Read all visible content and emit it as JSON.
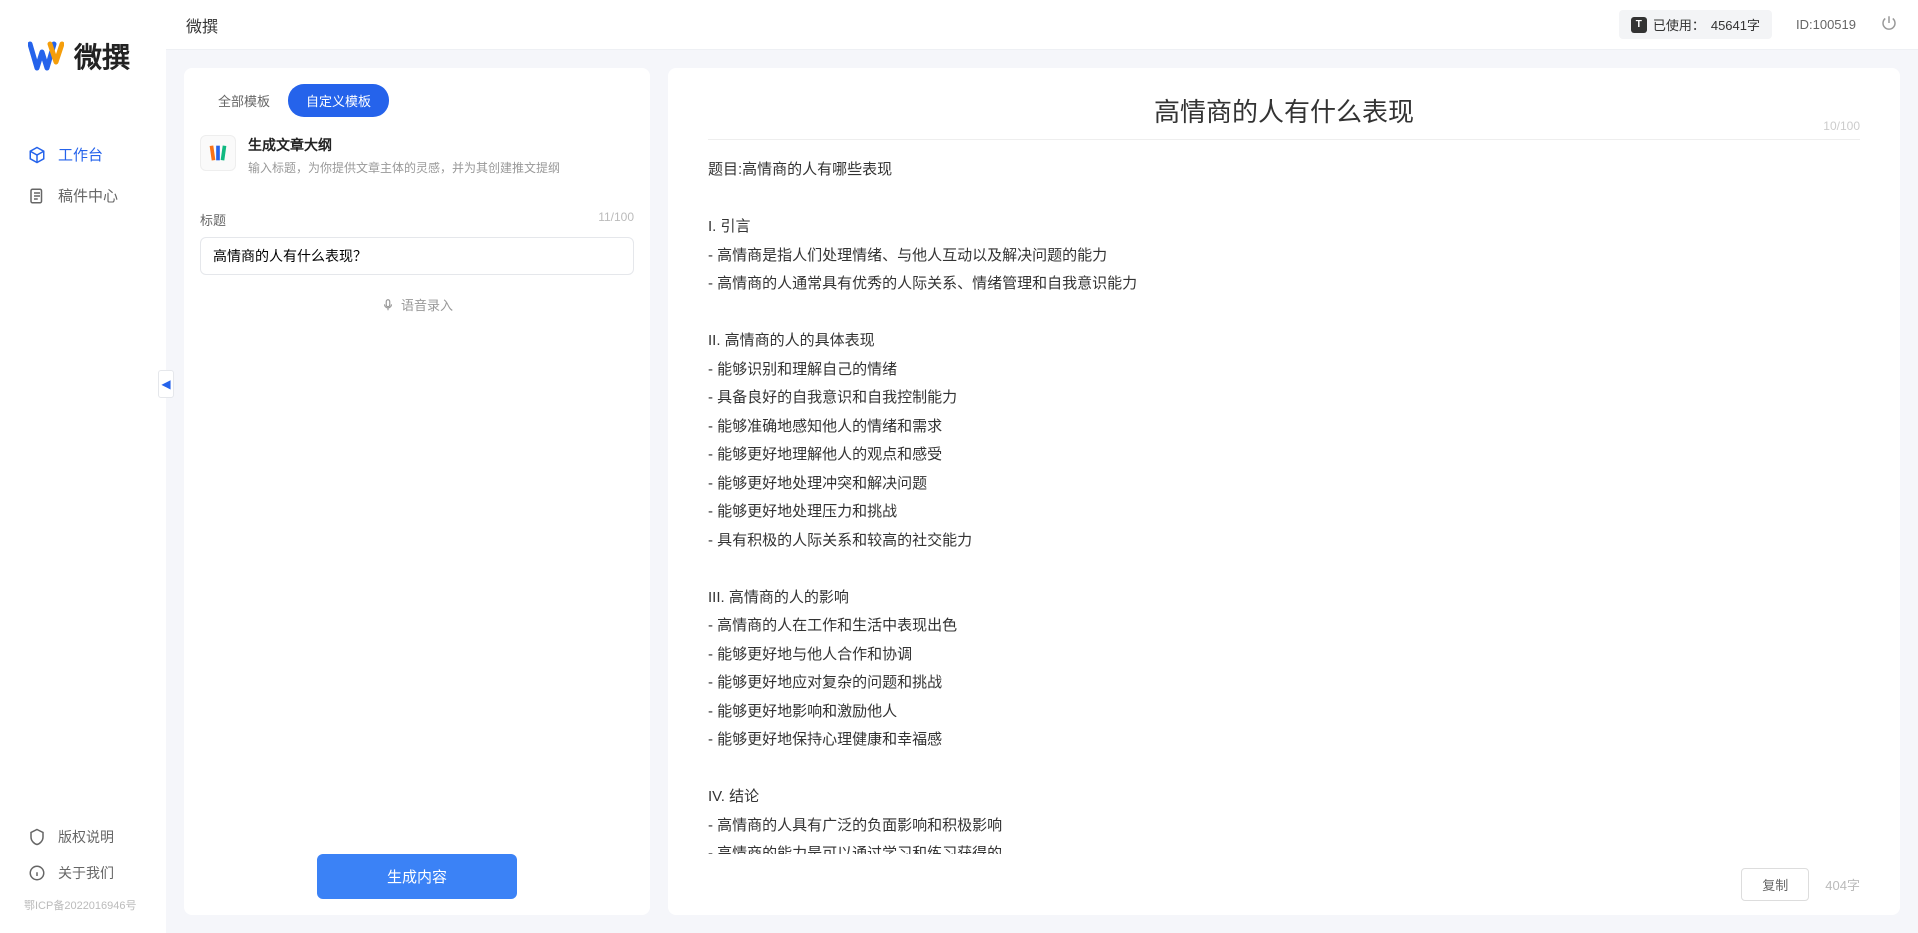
{
  "app": {
    "name": "微撰",
    "breadcrumb": "微撰"
  },
  "sidebar": {
    "nav": [
      {
        "label": "工作台",
        "active": true
      },
      {
        "label": "稿件中心",
        "active": false
      }
    ],
    "footer": [
      {
        "label": "版权说明"
      },
      {
        "label": "关于我们"
      }
    ],
    "icp": "鄂ICP备2022016946号"
  },
  "topbar": {
    "usage_prefix": "已使用：",
    "usage_value": "45641字",
    "user_id": "ID:100519"
  },
  "left": {
    "tabs": [
      {
        "label": "全部模板",
        "active": false
      },
      {
        "label": "自定义模板",
        "active": true
      }
    ],
    "template": {
      "title": "生成文章大纲",
      "desc": "输入标题，为你提供文章主体的灵感，并为其创建推文提纲"
    },
    "form": {
      "label": "标题",
      "counter": "11/100",
      "value": "高情商的人有什么表现？"
    },
    "voice_label": "语音录入",
    "generate_label": "生成内容"
  },
  "output": {
    "title": "高情商的人有什么表现",
    "title_counter": "10/100",
    "body": "题目:高情商的人有哪些表现\n\nI. 引言\n- 高情商是指人们处理情绪、与他人互动以及解决问题的能力\n- 高情商的人通常具有优秀的人际关系、情绪管理和自我意识能力\n\nII. 高情商的人的具体表现\n- 能够识别和理解自己的情绪\n- 具备良好的自我意识和自我控制能力\n- 能够准确地感知他人的情绪和需求\n- 能够更好地理解他人的观点和感受\n- 能够更好地处理冲突和解决问题\n- 能够更好地处理压力和挑战\n- 具有积极的人际关系和较高的社交能力\n\nIII. 高情商的人的影响\n- 高情商的人在工作和生活中表现出色\n- 能够更好地与他人合作和协调\n- 能够更好地应对复杂的问题和挑战\n- 能够更好地影响和激励他人\n- 能够更好地保持心理健康和幸福感\n\nIV. 结论\n- 高情商的人具有广泛的负面影响和积极影响\n- 高情商的能力是可以通过学习和练习获得的\n- 培养和提高高情商的能力对于个人的职业发展和生活质量至关重要。",
    "copy_label": "复制",
    "word_count": "404字"
  }
}
